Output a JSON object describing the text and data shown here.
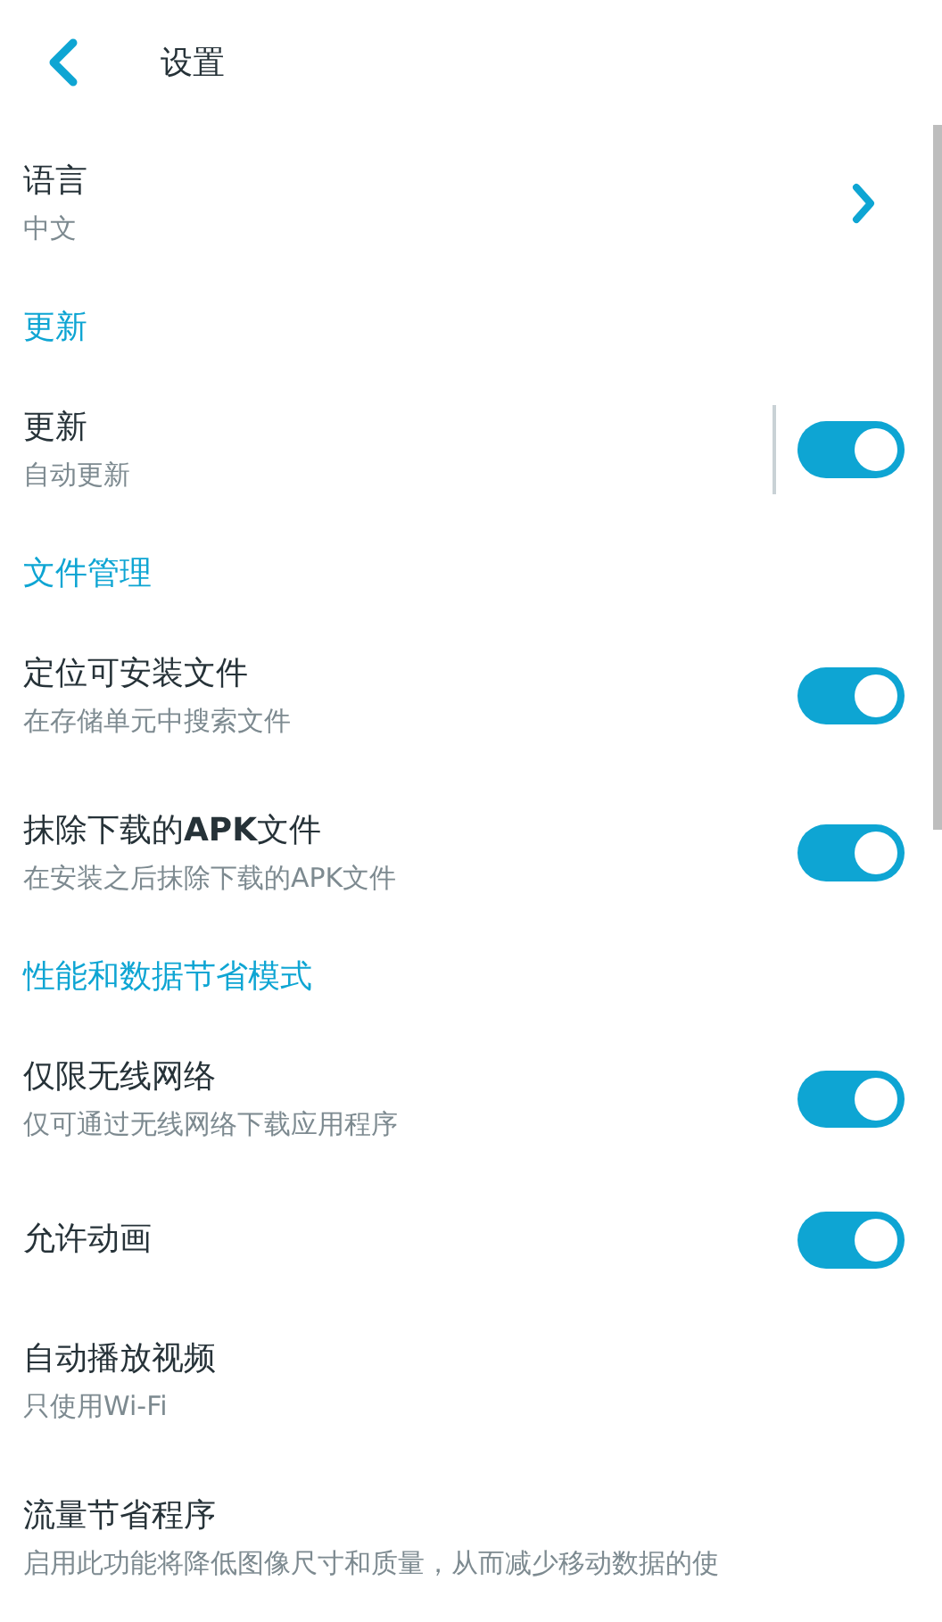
{
  "header": {
    "title": "设置"
  },
  "items": [
    {
      "kind": "nav",
      "title": "语言",
      "subtitle": "中文"
    },
    {
      "kind": "section",
      "title": "更新"
    },
    {
      "kind": "toggle",
      "title": "更新",
      "subtitle": "自动更新",
      "on": true,
      "divider": true
    },
    {
      "kind": "section",
      "title": "文件管理"
    },
    {
      "kind": "toggle",
      "title": "定位可安装文件",
      "subtitle": "在存储单元中搜索文件",
      "on": true
    },
    {
      "kind": "toggle",
      "title": "抹除下载的**APK**文件",
      "subtitle": "在安装之后抹除下载的APK文件",
      "on": true
    },
    {
      "kind": "section",
      "title": "性能和数据节省模式"
    },
    {
      "kind": "toggle",
      "title": "仅限无线网络",
      "subtitle": "仅可通过无线网络下载应用程序",
      "on": true
    },
    {
      "kind": "toggle",
      "title": "允许动画",
      "on": true
    },
    {
      "kind": "nav",
      "title": "自动播放视频",
      "subtitle": "只使用Wi-Fi",
      "arrow": false
    },
    {
      "kind": "nav",
      "title": "流量节省程序",
      "subtitle": "启用此功能将降低图像尺寸和质量，从而减少移动数据的使",
      "arrow": false
    }
  ]
}
